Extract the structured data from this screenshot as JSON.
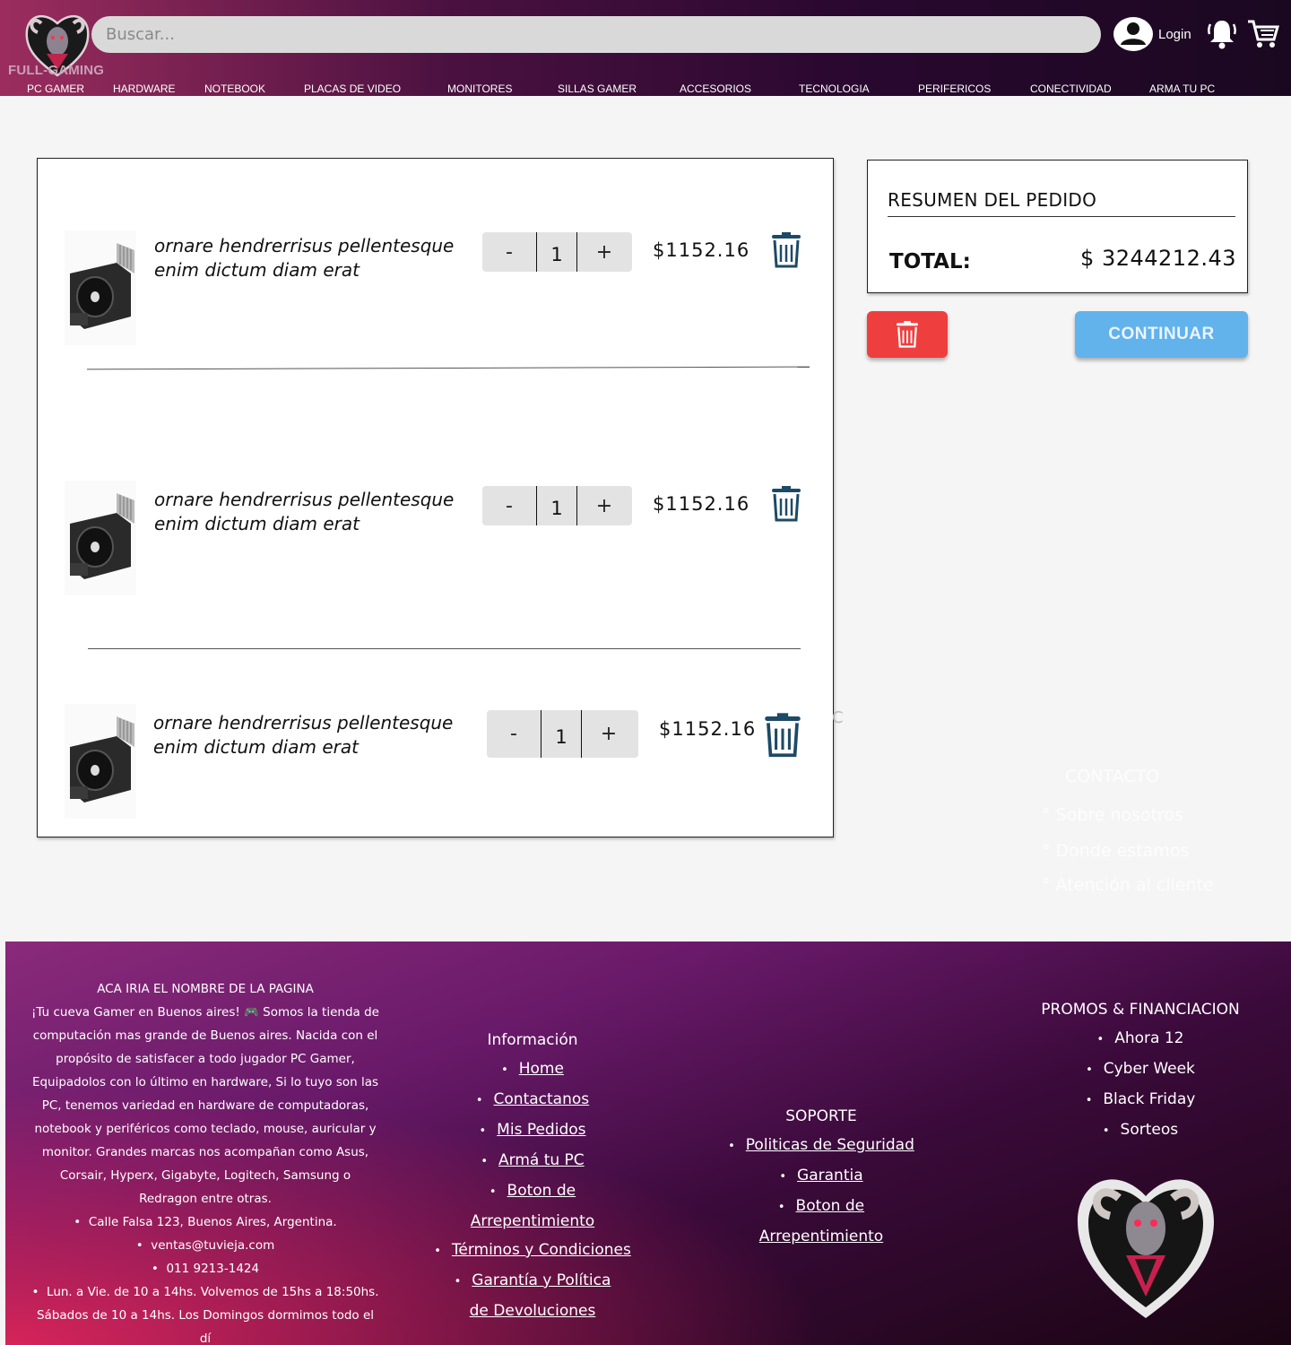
{
  "header": {
    "brand": "FULL-GAMING",
    "search_placeholder": "Buscar...",
    "login_label": "Login",
    "icons": [
      "user-icon",
      "bell-icon",
      "cart-icon"
    ]
  },
  "nav": {
    "items": [
      "PC GAMER",
      "HARDWARE",
      "NOTEBOOK",
      "PLACAS DE VIDEO",
      "MONITORES",
      "SILLAS GAMER",
      "ACCESORIOS",
      "TECNOLOGIA",
      "PERIFERICOS",
      "CONECTIVIDAD",
      "ARMA TU PC"
    ]
  },
  "cart": {
    "items": [
      {
        "name": "ornare hendrerrisus pellentesque enim dictum diam erat",
        "quantity": "1",
        "price": "$1152.16",
        "minus": "-",
        "plus": "+"
      },
      {
        "name": "ornare hendrerrisus pellentesque enim dictum diam erat",
        "quantity": "1",
        "price": "$1152.16",
        "minus": "-",
        "plus": "+"
      },
      {
        "name": "ornare hendrerrisus pellentesque enim dictum diam erat",
        "quantity": "1",
        "price": "$1152.16",
        "minus": "-",
        "plus": "+"
      }
    ]
  },
  "summary": {
    "title": "RESUMEN DEL PEDIDO",
    "total_label": "TOTAL:",
    "total_value": "$ 3244212.43",
    "continue_label": "CONTINUAR"
  },
  "ghost": {
    "stray_char": "C",
    "contact_title": "CONTACTO",
    "links": [
      "° Sobre nosotros",
      "° Donde estamos",
      "° Atención al cliente"
    ]
  },
  "footer": {
    "about_title": "ACA IRIA EL NOMBRE DE LA PAGINA",
    "about_text": "¡Tu cueva Gamer en Buenos aires! 🎮 Somos la tienda de computación mas grande de Buenos aires. Nacida con el propósito de satisfacer a todo jugador PC Gamer, Equipadolos con lo último en hardware, Si lo tuyo son las PC, tenemos variedad en hardware de computadoras, notebook y periféricos como teclado, mouse, auricular y monitor. Grandes marcas nos acompañan como Asus, Corsair, Hyperx, Gigabyte, Logitech, Samsung o Redragon entre otras.",
    "address": "Calle Falsa 123, Buenos Aires, Argentina.",
    "email": "ventas@tuvieja.com",
    "phone": "011 9213-1424",
    "hours": "Lun. a Vie. de 10 a 14hs. Volvemos de 15hs a 18:50hs. Sábados de 10 a 14hs. Los Domingos dormimos todo el dí",
    "info_title": "Información",
    "info_links": [
      "Home",
      "Contactanos",
      "Mis Pedidos",
      "Armá tu PC",
      "Boton de Arrepentimiento",
      "Términos y Condiciones",
      "Garantía y Política de Devoluciones"
    ],
    "support_title": "SOPORTE",
    "support_links": [
      "Politicas de Seguridad",
      "Garantia",
      "Boton de Arrepentimiento"
    ],
    "promos_title": "PROMOS & FINANCIACION",
    "promos": [
      "Ahora 12",
      "Cyber Week",
      "Black Friday",
      "Sorteos"
    ]
  },
  "colors": {
    "header_gradient_start": "#9b2d5e",
    "header_gradient_end": "#1a0820",
    "clear_button": "#ef3e3e",
    "continue_button": "#62b2ec",
    "trash_icon": "#1d4a66"
  }
}
